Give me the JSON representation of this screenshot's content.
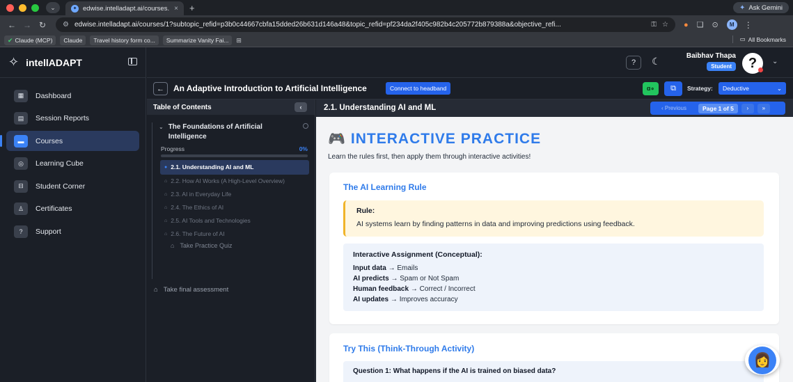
{
  "browser": {
    "tab_title": "edwise.intelladapt.ai/courses...",
    "tab_close": "×",
    "new_tab": "+",
    "gemini_label": "Ask Gemini",
    "url": "edwise.intelladapt.ai/courses/1?subtopic_refid=p3b0c44667cbfa15dded26b631d146a48&topic_refid=pf234da2f405c982b4c205772b879388a&objective_refi...",
    "profile_initial": "M",
    "bookmarks": [
      "Claude (MCP)",
      "Claude",
      "Travel history form co...",
      "Summarize Vanity Fai..."
    ],
    "all_bookmarks": "All Bookmarks"
  },
  "sidebar": {
    "brand": "intellADAPT",
    "items": [
      {
        "label": "Dashboard",
        "icon": "dashboard-icon"
      },
      {
        "label": "Session Reports",
        "icon": "report-icon"
      },
      {
        "label": "Courses",
        "icon": "courses-icon"
      },
      {
        "label": "Learning Cube",
        "icon": "cube-icon"
      },
      {
        "label": "Student Corner",
        "icon": "student-icon"
      },
      {
        "label": "Certificates",
        "icon": "certificate-icon"
      },
      {
        "label": "Support",
        "icon": "support-icon"
      }
    ],
    "active_index": 2
  },
  "header": {
    "user_name": "Baibhav Thapa",
    "user_role": "Student",
    "avatar_glyph": "?"
  },
  "course": {
    "title": "An Adaptive Introduction to Artificial Intelligence",
    "connect_label": "Connect to headband",
    "strategy_label": "Strategy:",
    "strategy_value": "Deductive"
  },
  "toc": {
    "heading": "Table of Contents",
    "chapter_title": "The Foundations of Artificial Intelligence",
    "progress_label": "Progress",
    "progress_value": "0%",
    "progress_fraction": 0,
    "lessons": [
      "2.1. Understanding AI and ML",
      "2.2. How AI Works (A High-Level Overview)",
      "2.3. AI in Everyday Life",
      "2.4. The Ethics of AI",
      "2.5. AI Tools and Technologies",
      "2.6. The Future of AI"
    ],
    "active_lesson": 0,
    "practice_quiz": "Take Practice Quiz",
    "final_assessment": "Take final assessment"
  },
  "content": {
    "lesson_title": "2.1. Understanding AI and ML",
    "pager_prev": "‹ Previous",
    "pager_page": "Page 1 of 5",
    "pager_next": "›",
    "pager_last": "»",
    "practice_heading": "INTERACTIVE PRACTICE",
    "intro": "Learn the rules first, then apply them through interactive activities!",
    "rule_card_title": "The AI Learning Rule",
    "rule_label": "Rule:",
    "rule_text": "AI systems learn by finding patterns in data and improving predictions using feedback.",
    "assignment_title": "Interactive Assignment (Conceptual):",
    "assignment_rows": [
      {
        "key": "Input data",
        "value": "Emails"
      },
      {
        "key": "AI predicts",
        "value": "Spam or Not Spam"
      },
      {
        "key": "Human feedback",
        "value": "Correct / Incorrect"
      },
      {
        "key": "AI updates",
        "value": "Improves accuracy"
      }
    ],
    "arrow": "→",
    "try_title": "Try This (Think-Through Activity)",
    "question_1": "Question 1: What happens if the AI is trained on biased data?"
  },
  "colors": {
    "accent": "#3b82f6",
    "heading_blue": "#2f7bea",
    "rule_border": "#f0b429",
    "green": "#22c55e"
  }
}
